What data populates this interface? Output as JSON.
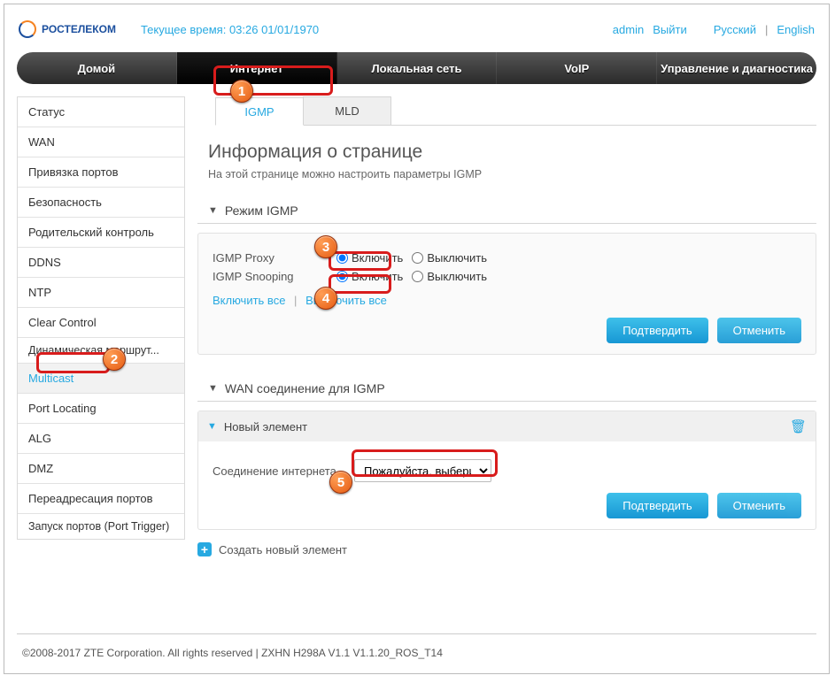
{
  "header": {
    "brand": "РОСТЕЛЕКОМ",
    "time_label": "Текущее время:",
    "time_value": "03:26 01/01/1970",
    "links": {
      "user": "admin",
      "logout": "Выйти",
      "lang_ru": "Русский",
      "lang_en": "English"
    }
  },
  "nav": {
    "items": [
      "Домой",
      "Интернет",
      "Локальная сеть",
      "VoIP",
      "Управление и диагностика"
    ],
    "active": 1
  },
  "sidebar": {
    "items": [
      "Статус",
      "WAN",
      "Привязка портов",
      "Безопасность",
      "Родительский контроль",
      "DDNS",
      "NTP",
      "Clear Control",
      "Динамическая маршрут...",
      "Multicast",
      "Port Locating",
      "ALG",
      "DMZ",
      "Переадресация портов",
      "Запуск портов (Port Trigger)"
    ],
    "active": 9
  },
  "subtabs": {
    "items": [
      "IGMP",
      "MLD"
    ],
    "active": 0
  },
  "page": {
    "title": "Информация о странице",
    "desc": "На этой странице можно настроить параметры IGMP"
  },
  "section_igmp": {
    "heading": "Режим IGMP",
    "proxy_label": "IGMP Proxy",
    "snooping_label": "IGMP Snooping",
    "on": "Включить",
    "off": "Выключить",
    "enable_all": "Включить все",
    "disable_all": "Выключить все",
    "confirm": "Подтвердить",
    "cancel": "Отменить"
  },
  "section_wan": {
    "heading": "WAN соединение для IGMP",
    "new_item": "Новый элемент",
    "conn_label": "Соединение интернета",
    "select_placeholder": "Пожалуйста, выбери",
    "confirm": "Подтвердить",
    "cancel": "Отменить",
    "create_new": "Создать новый элемент"
  },
  "footer": {
    "text": "©2008-2017 ZTE Corporation. All rights reserved   |   ZXHN H298A V1.1 V1.1.20_ROS_T14"
  },
  "annotations": {
    "n1": "1",
    "n2": "2",
    "n3": "3",
    "n4": "4",
    "n5": "5",
    "sep": "|"
  }
}
